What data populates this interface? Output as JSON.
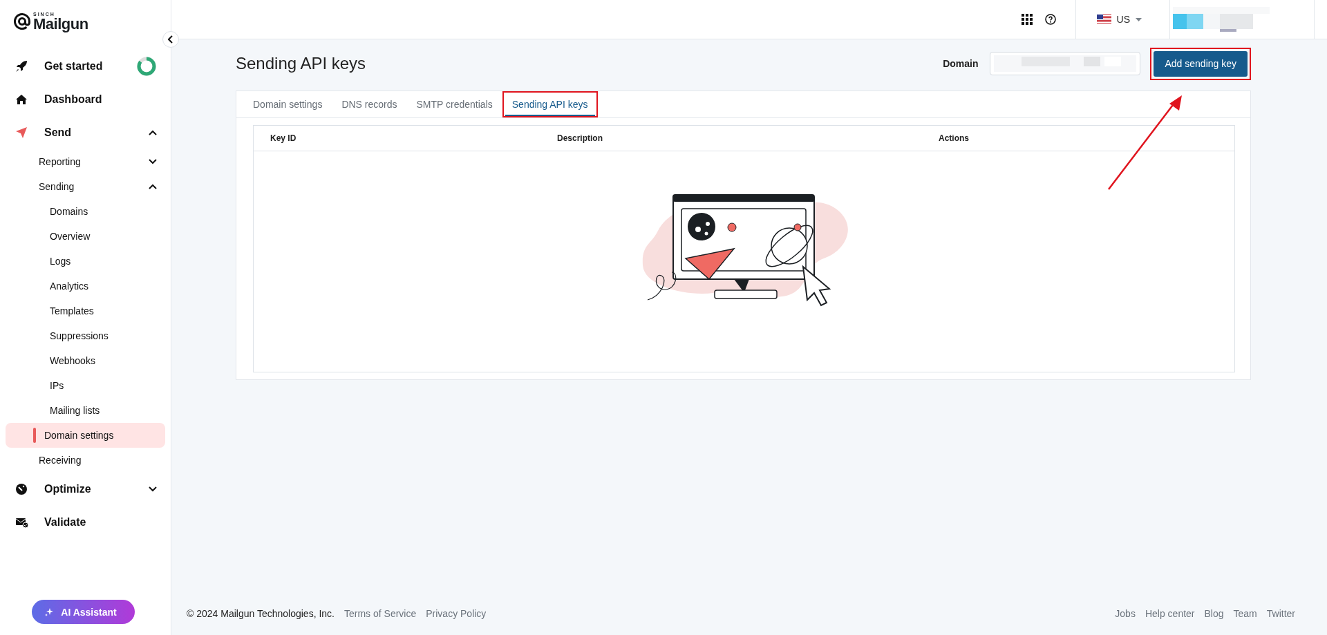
{
  "brand": {
    "small": "SINCH",
    "name": "Mailgun"
  },
  "nav": [
    {
      "label": "Get started",
      "selected": false,
      "level": 0.85
    },
    {
      "label": "Dashboard",
      "selected": false
    },
    {
      "label": "Send",
      "selected": false,
      "expanded": true,
      "children": [
        {
          "label": "Reporting",
          "selected": false,
          "expanded": false
        },
        {
          "label": "Sending",
          "selected": false,
          "expanded": true,
          "children": [
            {
              "label": "Domains",
              "selected": false
            },
            {
              "label": "Overview",
              "selected": false
            },
            {
              "label": "Logs",
              "selected": false
            },
            {
              "label": "Analytics",
              "selected": false
            },
            {
              "label": "Templates",
              "selected": false
            },
            {
              "label": "Suppressions",
              "selected": false
            },
            {
              "label": "Webhooks",
              "selected": false
            },
            {
              "label": "IPs",
              "selected": false
            },
            {
              "label": "Mailing lists",
              "selected": false
            },
            {
              "label": "Domain settings",
              "selected": true
            }
          ]
        },
        {
          "label": "Receiving",
          "selected": false
        }
      ]
    },
    {
      "label": "Optimize",
      "selected": false,
      "expanded": false
    },
    {
      "label": "Validate",
      "selected": false
    }
  ],
  "assistant_button": "AI Assistant",
  "topbar": {
    "region": "US"
  },
  "page": {
    "title": "Sending API keys",
    "domain_label": "Domain",
    "add_button": {
      "label": "Add sending key",
      "highlighted": true
    }
  },
  "tabs": [
    {
      "label": "Domain settings",
      "selected": false,
      "highlighted": false
    },
    {
      "label": "DNS records",
      "selected": false,
      "highlighted": false
    },
    {
      "label": "SMTP credentials",
      "selected": false,
      "highlighted": false
    },
    {
      "label": "Sending API keys",
      "selected": true,
      "highlighted": true
    }
  ],
  "table": {
    "columns": [
      "Key ID",
      "Description",
      "Actions"
    ]
  },
  "annotation_arrow": true,
  "footer": {
    "copyright": "© 2024 Mailgun Technologies, Inc.",
    "left_links": [
      "Terms of Service",
      "Privacy Policy"
    ],
    "right_links": [
      "Jobs",
      "Help center",
      "Blog",
      "Team",
      "Twitter"
    ]
  }
}
